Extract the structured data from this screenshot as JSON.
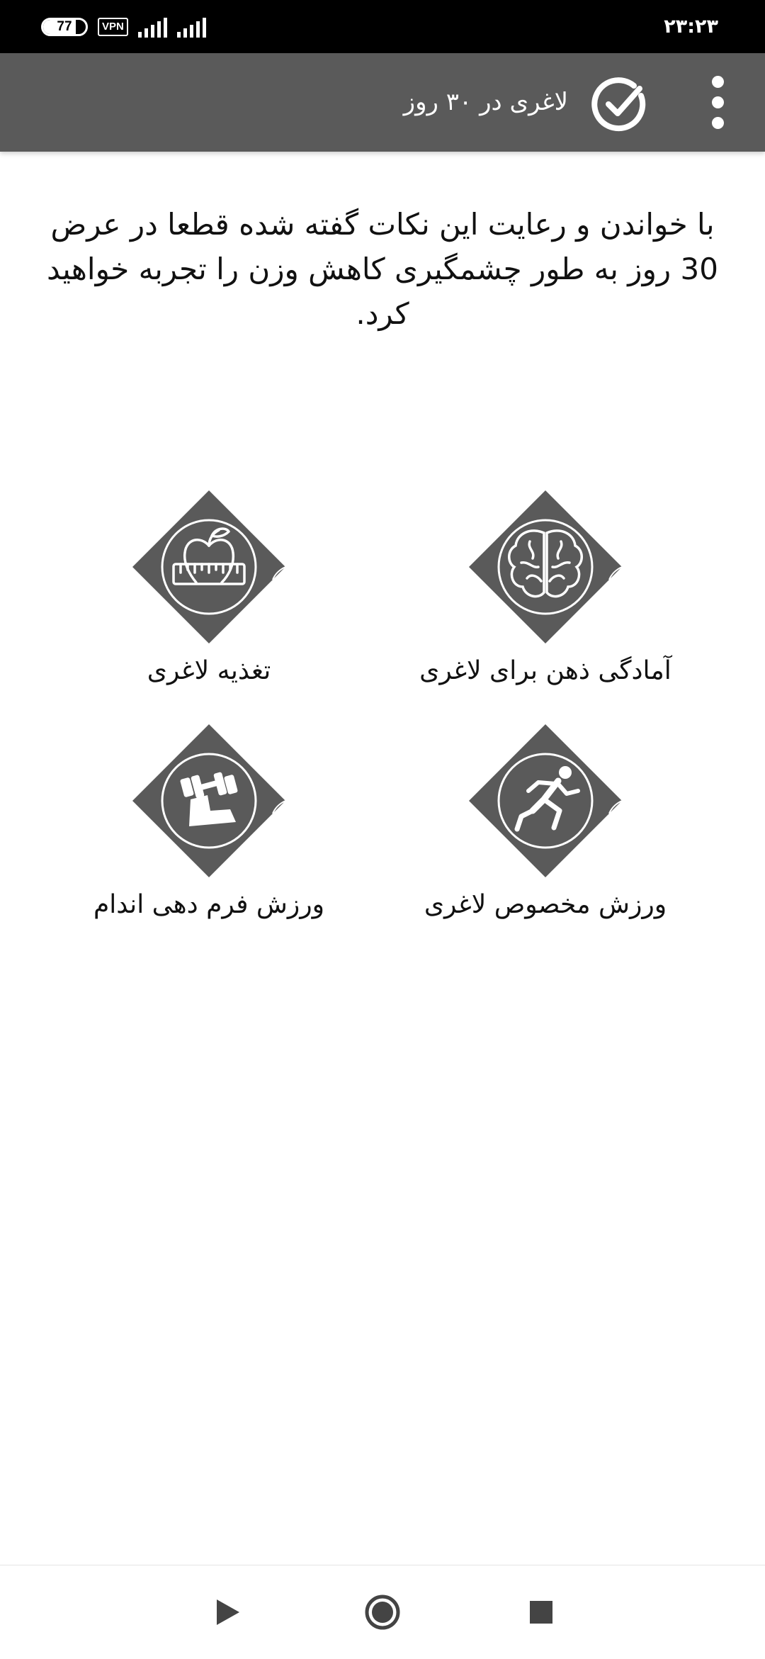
{
  "status_bar": {
    "battery_level": 77,
    "battery_label": "77",
    "vpn_label": "VPN",
    "time": "۲۳:۲۳",
    "icons": [
      "battery-icon",
      "vpn-icon",
      "signal-icon",
      "signal-icon"
    ]
  },
  "app_bar": {
    "title": "لاغری در ۳۰ روز",
    "icons": [
      "overflow-menu-icon",
      "check-circle-icon"
    ],
    "background_color": "#5a5a5a"
  },
  "intro": {
    "text": "با خواندن و رعایت این نکات گفته شده قطعا در عرض 30 روز به طور چشمگیری کاهش وزن را تجربه خواهید کرد."
  },
  "categories": [
    {
      "label": "آمادگی ذهن برای لاغری",
      "icon": "brain-icon"
    },
    {
      "label": "تغذیه لاغری",
      "icon": "apple-measuring-tape-icon"
    },
    {
      "label": "ورزش مخصوص لاغری",
      "icon": "running-man-icon"
    },
    {
      "label": "ورزش فرم دهی اندام",
      "icon": "dumbbell-icon"
    }
  ],
  "nav_bar": {
    "icons": [
      "back-triangle-icon",
      "home-circle-icon",
      "recents-square-icon"
    ]
  },
  "colors": {
    "tile": "#5a5a5a",
    "icon_line": "#ffffff",
    "status_bar": "#000000",
    "nav_icon": "#444444"
  }
}
